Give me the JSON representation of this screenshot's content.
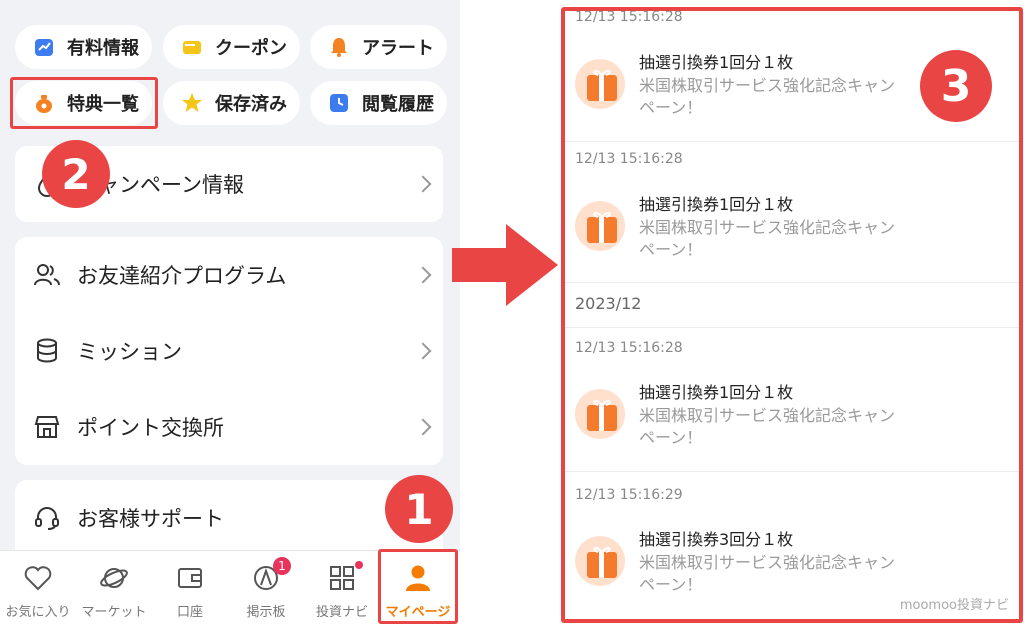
{
  "quick_links": [
    {
      "label": "有料情報",
      "icon": "chart-bag-icon"
    },
    {
      "label": "クーポン",
      "icon": "coupon-icon"
    },
    {
      "label": "アラート",
      "icon": "bell-icon"
    },
    {
      "label": "特典一覧",
      "icon": "money-bag-icon"
    },
    {
      "label": "保存済み",
      "icon": "star-icon"
    },
    {
      "label": "閲覧履歴",
      "icon": "history-icon"
    }
  ],
  "campaign_row": {
    "label": "キャンペーン情報",
    "icon": "flame-icon"
  },
  "menu_rows": [
    {
      "label": "お友達紹介プログラム",
      "icon": "people-icon"
    },
    {
      "label": "ミッション",
      "icon": "coins-icon"
    },
    {
      "label": "ポイント交換所",
      "icon": "shop-icon"
    }
  ],
  "support_row": {
    "label": "お客様サポート",
    "icon": "headset-icon"
  },
  "tabs": [
    {
      "label": "お気に入り",
      "icon": "heart-icon"
    },
    {
      "label": "マーケット",
      "icon": "planet-icon"
    },
    {
      "label": "口座",
      "icon": "wallet-icon"
    },
    {
      "label": "掲示板",
      "icon": "board-icon",
      "badge": "1"
    },
    {
      "label": "投資ナビ",
      "icon": "grid-icon"
    },
    {
      "label": "マイページ",
      "icon": "person-icon"
    }
  ],
  "callouts": [
    "1",
    "2",
    "3"
  ],
  "notifications": {
    "top_timestamp": "12/13 15:16:28",
    "month_header": "2023/12",
    "items": [
      {
        "timestamp": "12/13 15:16:28",
        "title": "抽選引換券1回分１枚",
        "desc": "米国株取引サービス強化記念キャンペーン！"
      },
      {
        "timestamp": "12/13 15:16:28",
        "title": "抽選引換券1回分１枚",
        "desc": "米国株取引サービス強化記念キャンペーン！"
      },
      {
        "timestamp": "12/13 15:16:28",
        "title": "抽選引換券1回分１枚",
        "desc": "米国株取引サービス強化記念キャンペーン！"
      },
      {
        "timestamp": "12/13 15:16:29",
        "title": "抽選引換券3回分１枚",
        "desc": "米国株取引サービス強化記念キャンペーン！"
      }
    ]
  },
  "watermark": "moomoo投資ナビ",
  "colors": {
    "accent": "#f57c00",
    "highlight": "#e94545",
    "badge": "#e8335c"
  }
}
